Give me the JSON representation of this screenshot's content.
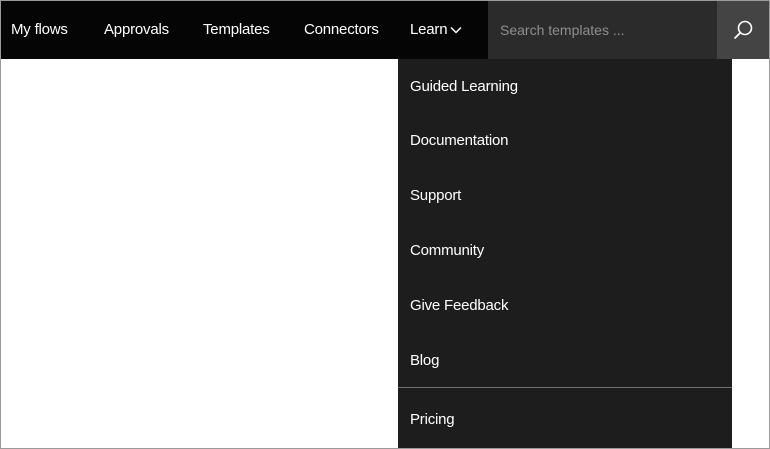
{
  "nav": {
    "items": [
      {
        "label": "My flows"
      },
      {
        "label": "Approvals"
      },
      {
        "label": "Templates"
      },
      {
        "label": "Connectors"
      },
      {
        "label": "Learn"
      }
    ],
    "learn_chevron_icon": "chevron-down-icon"
  },
  "search": {
    "placeholder": "Search templates ...",
    "button_icon": "search-icon"
  },
  "learn_menu": {
    "items": [
      {
        "label": "Guided Learning"
      },
      {
        "label": "Documentation"
      },
      {
        "label": "Support"
      },
      {
        "label": "Community"
      },
      {
        "label": "Give Feedback"
      },
      {
        "label": "Blog"
      }
    ],
    "footer_items": [
      {
        "label": "Pricing"
      }
    ]
  },
  "colors": {
    "topbar": "#050505",
    "search_field": "#2b2b2b",
    "search_button": "#444444",
    "dropdown": "#1d1d1d"
  }
}
